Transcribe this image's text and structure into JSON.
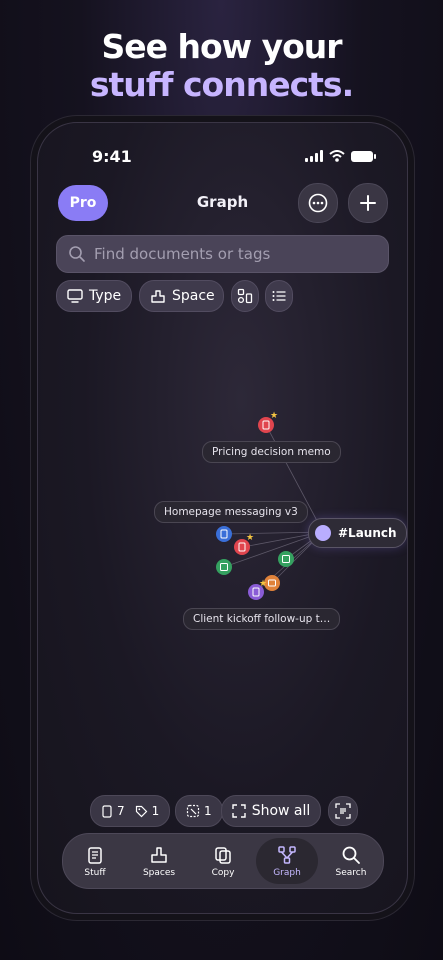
{
  "headline": {
    "line1": "See how your",
    "line2": "stuff connects."
  },
  "status": {
    "time": "9:41"
  },
  "header": {
    "pro_label": "Pro",
    "title": "Graph"
  },
  "search": {
    "placeholder": "Find documents or tags",
    "value": ""
  },
  "filters": [
    {
      "label": "Type"
    },
    {
      "label": "Space"
    }
  ],
  "graph": {
    "labels": {
      "pricing": "Pricing decision memo",
      "homepage": "Homepage messaging v3",
      "client": "Client kickoff follow-up t…"
    },
    "tag_node": "#Launch"
  },
  "counters": {
    "docs": "7",
    "tags": "1",
    "selected": "1"
  },
  "show_all": "Show all",
  "tabs": [
    {
      "label": "Stuff"
    },
    {
      "label": "Spaces"
    },
    {
      "label": "Copy"
    },
    {
      "label": "Graph"
    },
    {
      "label": "Search"
    }
  ],
  "colors": {
    "accent": "#8a7cf5",
    "headline_accent": "#c7b5ff",
    "tag_dot": "#b9adff"
  }
}
